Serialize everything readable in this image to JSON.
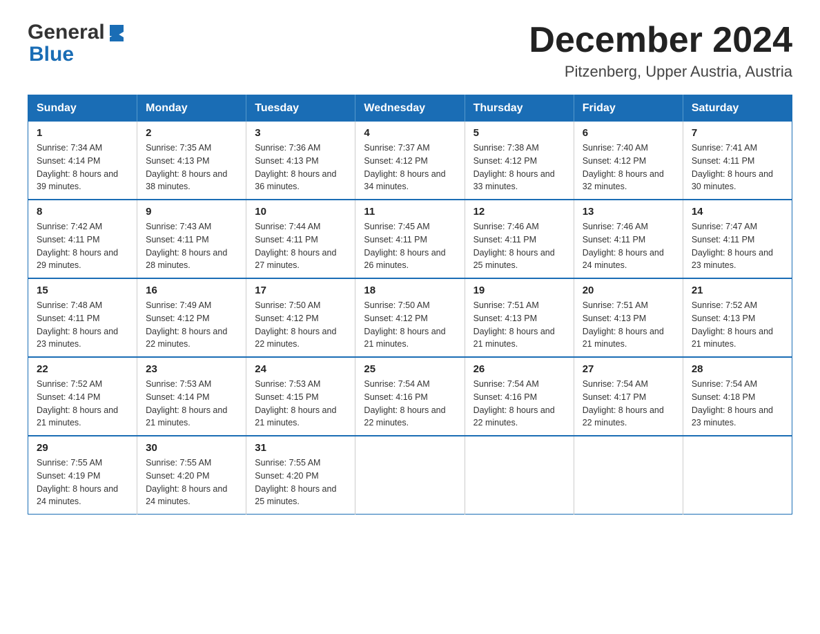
{
  "header": {
    "logo_general": "General",
    "logo_blue": "Blue",
    "month_title": "December 2024",
    "location": "Pitzenberg, Upper Austria, Austria"
  },
  "calendar": {
    "days_of_week": [
      "Sunday",
      "Monday",
      "Tuesday",
      "Wednesday",
      "Thursday",
      "Friday",
      "Saturday"
    ],
    "weeks": [
      [
        {
          "day": "1",
          "sunrise": "7:34 AM",
          "sunset": "4:14 PM",
          "daylight": "8 hours and 39 minutes."
        },
        {
          "day": "2",
          "sunrise": "7:35 AM",
          "sunset": "4:13 PM",
          "daylight": "8 hours and 38 minutes."
        },
        {
          "day": "3",
          "sunrise": "7:36 AM",
          "sunset": "4:13 PM",
          "daylight": "8 hours and 36 minutes."
        },
        {
          "day": "4",
          "sunrise": "7:37 AM",
          "sunset": "4:12 PM",
          "daylight": "8 hours and 34 minutes."
        },
        {
          "day": "5",
          "sunrise": "7:38 AM",
          "sunset": "4:12 PM",
          "daylight": "8 hours and 33 minutes."
        },
        {
          "day": "6",
          "sunrise": "7:40 AM",
          "sunset": "4:12 PM",
          "daylight": "8 hours and 32 minutes."
        },
        {
          "day": "7",
          "sunrise": "7:41 AM",
          "sunset": "4:11 PM",
          "daylight": "8 hours and 30 minutes."
        }
      ],
      [
        {
          "day": "8",
          "sunrise": "7:42 AM",
          "sunset": "4:11 PM",
          "daylight": "8 hours and 29 minutes."
        },
        {
          "day": "9",
          "sunrise": "7:43 AM",
          "sunset": "4:11 PM",
          "daylight": "8 hours and 28 minutes."
        },
        {
          "day": "10",
          "sunrise": "7:44 AM",
          "sunset": "4:11 PM",
          "daylight": "8 hours and 27 minutes."
        },
        {
          "day": "11",
          "sunrise": "7:45 AM",
          "sunset": "4:11 PM",
          "daylight": "8 hours and 26 minutes."
        },
        {
          "day": "12",
          "sunrise": "7:46 AM",
          "sunset": "4:11 PM",
          "daylight": "8 hours and 25 minutes."
        },
        {
          "day": "13",
          "sunrise": "7:46 AM",
          "sunset": "4:11 PM",
          "daylight": "8 hours and 24 minutes."
        },
        {
          "day": "14",
          "sunrise": "7:47 AM",
          "sunset": "4:11 PM",
          "daylight": "8 hours and 23 minutes."
        }
      ],
      [
        {
          "day": "15",
          "sunrise": "7:48 AM",
          "sunset": "4:11 PM",
          "daylight": "8 hours and 23 minutes."
        },
        {
          "day": "16",
          "sunrise": "7:49 AM",
          "sunset": "4:12 PM",
          "daylight": "8 hours and 22 minutes."
        },
        {
          "day": "17",
          "sunrise": "7:50 AM",
          "sunset": "4:12 PM",
          "daylight": "8 hours and 22 minutes."
        },
        {
          "day": "18",
          "sunrise": "7:50 AM",
          "sunset": "4:12 PM",
          "daylight": "8 hours and 21 minutes."
        },
        {
          "day": "19",
          "sunrise": "7:51 AM",
          "sunset": "4:13 PM",
          "daylight": "8 hours and 21 minutes."
        },
        {
          "day": "20",
          "sunrise": "7:51 AM",
          "sunset": "4:13 PM",
          "daylight": "8 hours and 21 minutes."
        },
        {
          "day": "21",
          "sunrise": "7:52 AM",
          "sunset": "4:13 PM",
          "daylight": "8 hours and 21 minutes."
        }
      ],
      [
        {
          "day": "22",
          "sunrise": "7:52 AM",
          "sunset": "4:14 PM",
          "daylight": "8 hours and 21 minutes."
        },
        {
          "day": "23",
          "sunrise": "7:53 AM",
          "sunset": "4:14 PM",
          "daylight": "8 hours and 21 minutes."
        },
        {
          "day": "24",
          "sunrise": "7:53 AM",
          "sunset": "4:15 PM",
          "daylight": "8 hours and 21 minutes."
        },
        {
          "day": "25",
          "sunrise": "7:54 AM",
          "sunset": "4:16 PM",
          "daylight": "8 hours and 22 minutes."
        },
        {
          "day": "26",
          "sunrise": "7:54 AM",
          "sunset": "4:16 PM",
          "daylight": "8 hours and 22 minutes."
        },
        {
          "day": "27",
          "sunrise": "7:54 AM",
          "sunset": "4:17 PM",
          "daylight": "8 hours and 22 minutes."
        },
        {
          "day": "28",
          "sunrise": "7:54 AM",
          "sunset": "4:18 PM",
          "daylight": "8 hours and 23 minutes."
        }
      ],
      [
        {
          "day": "29",
          "sunrise": "7:55 AM",
          "sunset": "4:19 PM",
          "daylight": "8 hours and 24 minutes."
        },
        {
          "day": "30",
          "sunrise": "7:55 AM",
          "sunset": "4:20 PM",
          "daylight": "8 hours and 24 minutes."
        },
        {
          "day": "31",
          "sunrise": "7:55 AM",
          "sunset": "4:20 PM",
          "daylight": "8 hours and 25 minutes."
        },
        null,
        null,
        null,
        null
      ]
    ]
  }
}
